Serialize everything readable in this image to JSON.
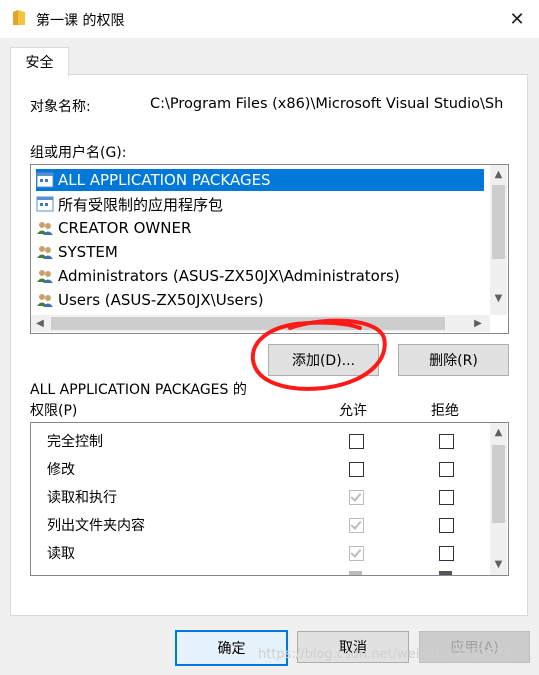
{
  "window": {
    "title": "第一课 的权限",
    "close_glyph": "✕"
  },
  "tab": {
    "label": "安全"
  },
  "object": {
    "label": "对象名称:",
    "value": "C:\\Program Files (x86)\\Microsoft Visual Studio\\Sh"
  },
  "groups": {
    "label": "组或用户名(G):",
    "items": [
      {
        "label": "ALL APPLICATION PACKAGES",
        "icon": "app-package-icon",
        "selected": true
      },
      {
        "label": "所有受限制的应用程序包",
        "icon": "app-package-icon",
        "selected": false
      },
      {
        "label": "CREATOR OWNER",
        "icon": "users-icon",
        "selected": false
      },
      {
        "label": "SYSTEM",
        "icon": "users-icon",
        "selected": false
      },
      {
        "label": "Administrators (ASUS-ZX50JX\\Administrators)",
        "icon": "users-icon",
        "selected": false
      },
      {
        "label": "Users (ASUS-ZX50JX\\Users)",
        "icon": "users-icon",
        "selected": false
      }
    ]
  },
  "buttons": {
    "add": "添加(D)...",
    "remove": "删除(R)",
    "ok": "确定",
    "cancel": "取消",
    "apply": "应用(A)"
  },
  "permissions": {
    "for_label": "ALL APPLICATION PACKAGES 的",
    "label": "权限(P)",
    "allow_header": "允许",
    "deny_header": "拒绝",
    "rows": [
      {
        "name": "完全控制",
        "allow": "unchecked",
        "deny": "unchecked"
      },
      {
        "name": "修改",
        "allow": "unchecked",
        "deny": "unchecked"
      },
      {
        "name": "读取和执行",
        "allow": "inherited-checked",
        "deny": "unchecked"
      },
      {
        "name": "列出文件夹内容",
        "allow": "inherited-checked",
        "deny": "unchecked"
      },
      {
        "name": "读取",
        "allow": "inherited-checked",
        "deny": "unchecked"
      }
    ]
  },
  "watermark": "https://blog.csdn.net/weixin_42152531",
  "colors": {
    "selection": "#0078d7",
    "annotation": "#ff0000"
  }
}
